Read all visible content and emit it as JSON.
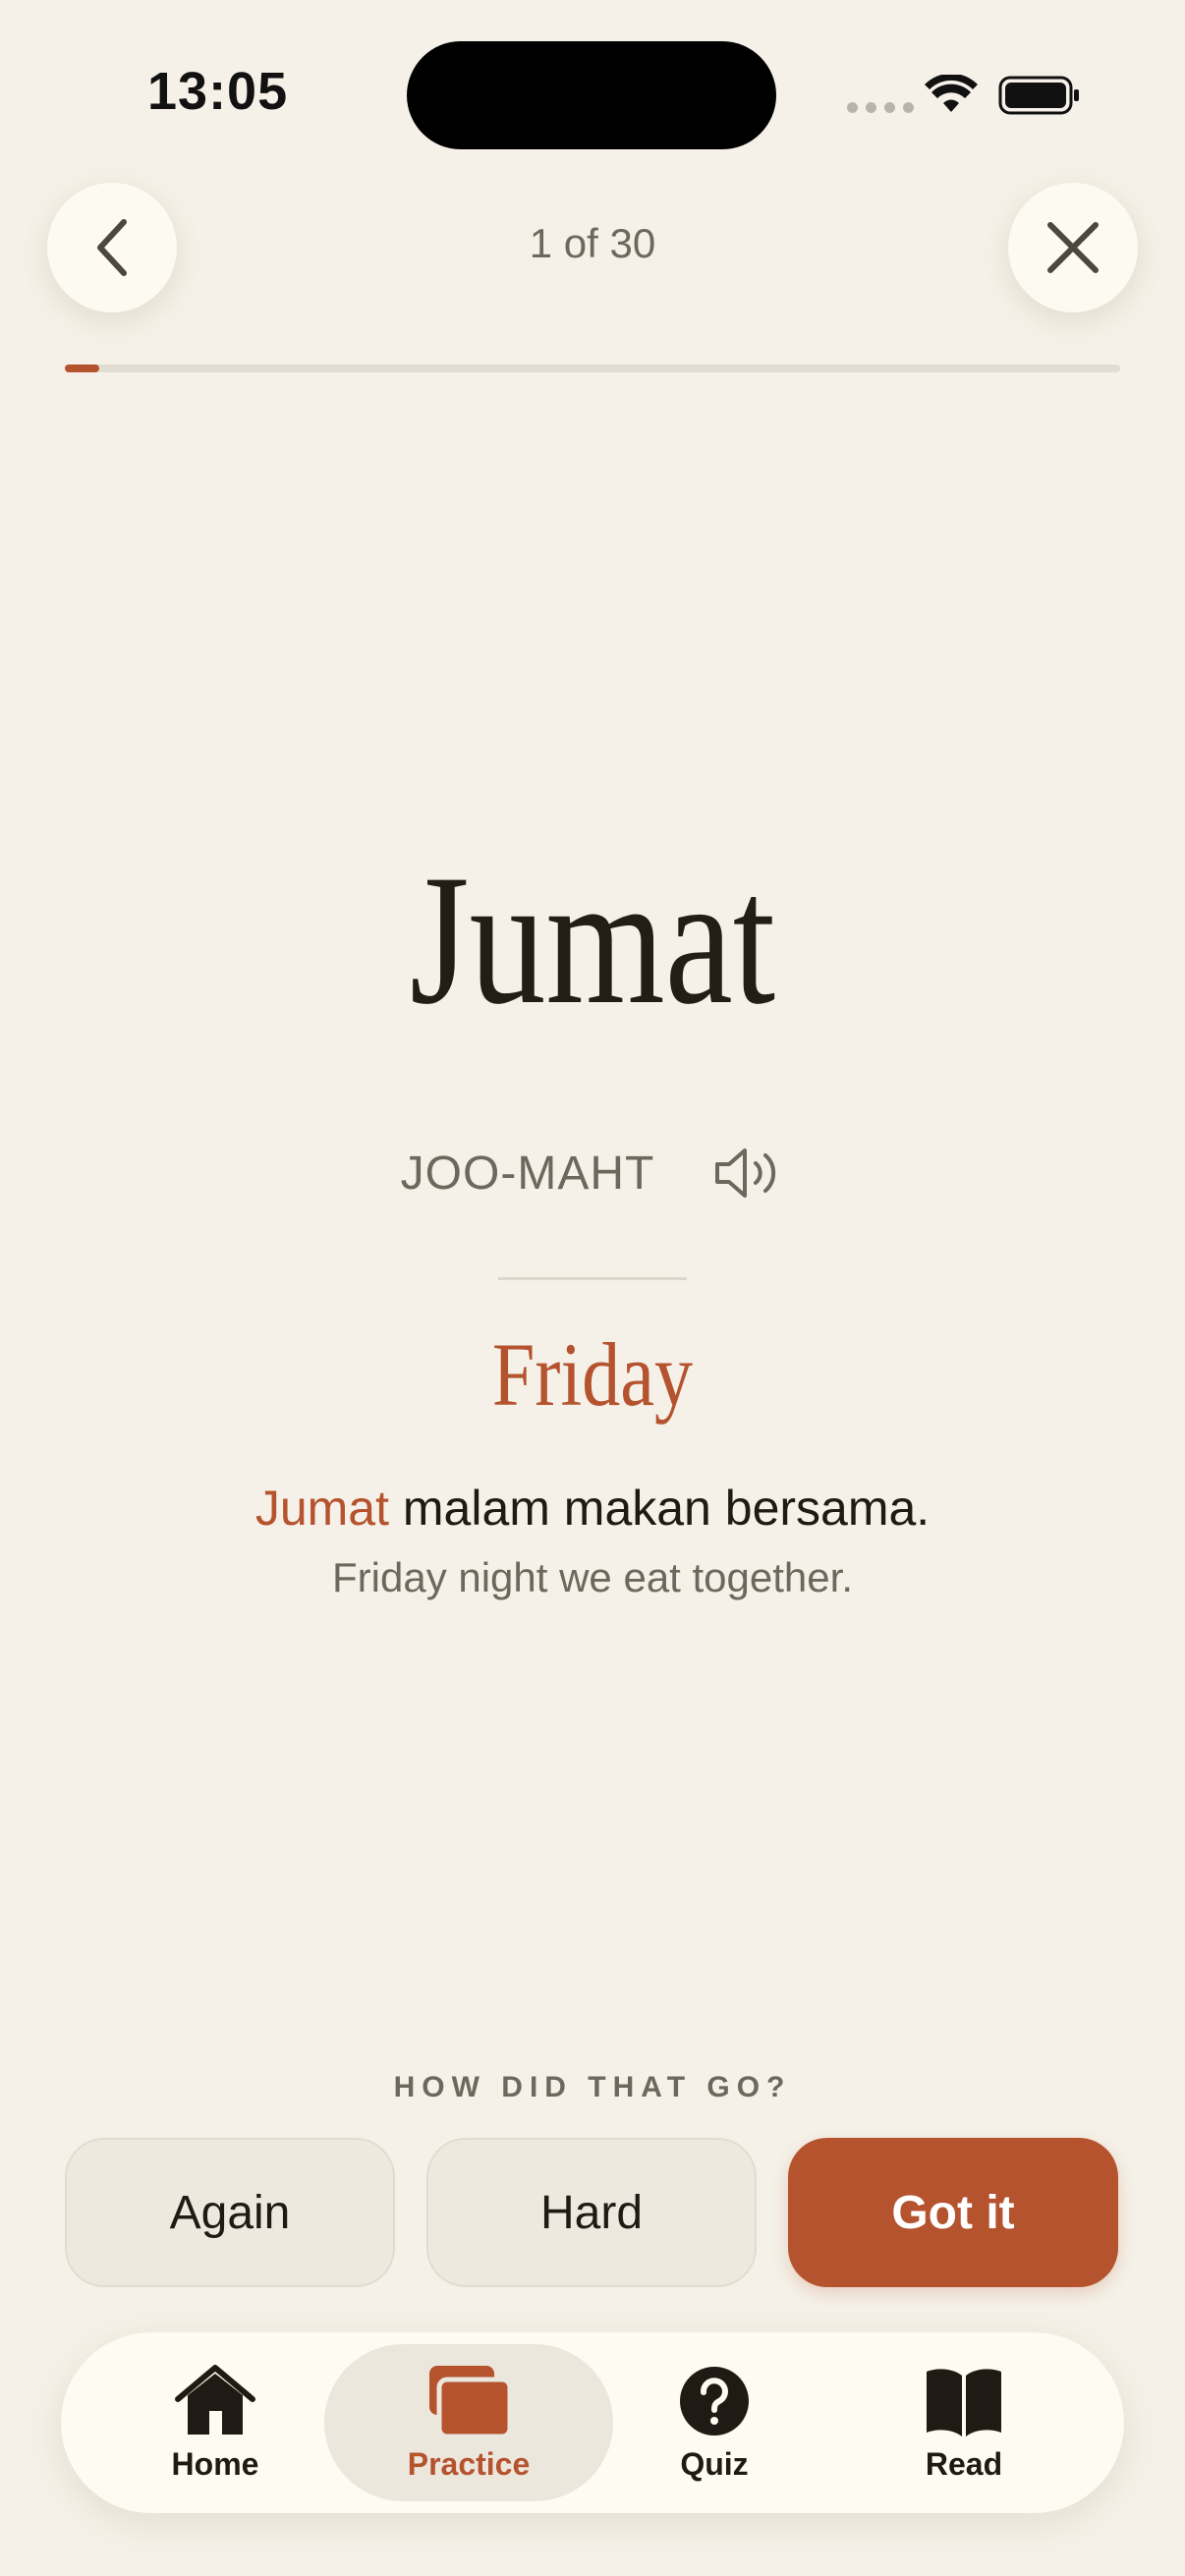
{
  "status_bar": {
    "time": "13:05"
  },
  "header": {
    "counter": "1 of 30",
    "back_icon": "chevron-left-icon",
    "close_icon": "close-icon"
  },
  "progress": {
    "current": 1,
    "total": 30,
    "fraction": 0.033
  },
  "card": {
    "word": "Jumat",
    "pronunciation": "JOO-MAHT",
    "speaker_icon": "speaker-icon",
    "translation": "Friday",
    "example": {
      "highlight": "Jumat",
      "rest": " malam makan bersama."
    },
    "example_translation": "Friday night we eat together."
  },
  "rating": {
    "prompt": "HOW DID THAT GO?",
    "again_label": "Again",
    "hard_label": "Hard",
    "gotit_label": "Got it"
  },
  "tab_bar": {
    "tabs": [
      {
        "label": "Home",
        "icon": "home-icon"
      },
      {
        "label": "Practice",
        "icon": "cards-icon",
        "active": true
      },
      {
        "label": "Quiz",
        "icon": "question-icon"
      },
      {
        "label": "Read",
        "icon": "book-icon"
      }
    ]
  },
  "colors": {
    "background": "#F5F1E8",
    "accent": "#B5532F",
    "text": "#1F1B14",
    "muted": "#6E675C"
  }
}
